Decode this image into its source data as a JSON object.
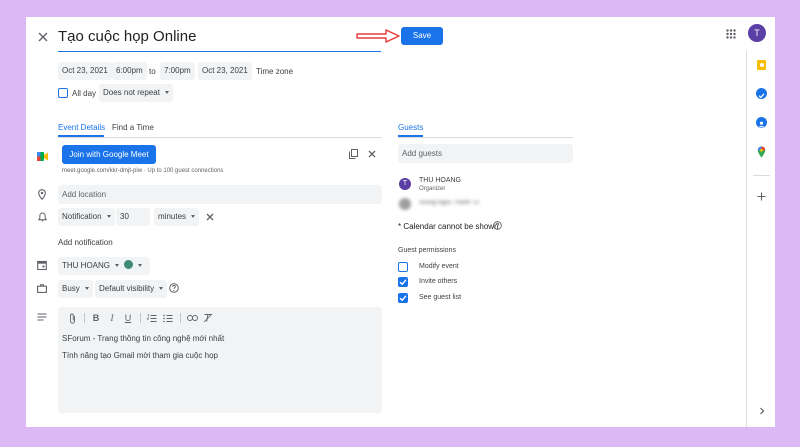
{
  "header": {
    "title": "Tạo cuộc họp Online",
    "save_label": "Save",
    "avatar_letter": "T"
  },
  "datetime": {
    "start_date": "Oct 23, 2021",
    "start_time": "6:00pm",
    "to_label": "to",
    "end_time": "7:00pm",
    "end_date": "Oct 23, 2021",
    "timezone_label": "Time zone",
    "all_day_label": "All day",
    "repeat_value": "Does not repeat"
  },
  "tabs": {
    "event_details": "Event Details",
    "find_time": "Find a Time",
    "guests": "Guests"
  },
  "meet": {
    "join_label": "Join with Google Meet",
    "link_info": "meet.google.com/kkr-dmjt-piw · Up to 100 guest connections"
  },
  "location": {
    "placeholder": "Add location"
  },
  "notification": {
    "type": "Notification",
    "amount": "30",
    "unit": "minutes",
    "add_label": "Add notification"
  },
  "calendar": {
    "owner": "THU HOANG",
    "color": "#3d8b72"
  },
  "availability": {
    "status": "Busy",
    "visibility": "Default visibility"
  },
  "description": {
    "line1": "SForum - Trang thông tin công nghệ mới nhất",
    "line2": "Tính năng tạo Gmail mời tham gia cuộc họp"
  },
  "guests": {
    "add_placeholder": "Add guests",
    "organizer_initial": "T",
    "organizer_name": "THU HOANG",
    "organizer_role": "Organizer",
    "guest2_blurred": "Vuong Ngoc Thanh Tu",
    "calendar_note": "* Calendar cannot be shown",
    "permissions_title": "Guest permissions",
    "permissions": [
      {
        "label": "Modify event",
        "checked": false
      },
      {
        "label": "Invite others",
        "checked": true
      },
      {
        "label": "See guest list",
        "checked": true
      }
    ]
  },
  "colors": {
    "accent": "#1a73e8",
    "arrow": "#e53935",
    "avatar": "#5b3fa6",
    "background": "#dcb8f5"
  }
}
